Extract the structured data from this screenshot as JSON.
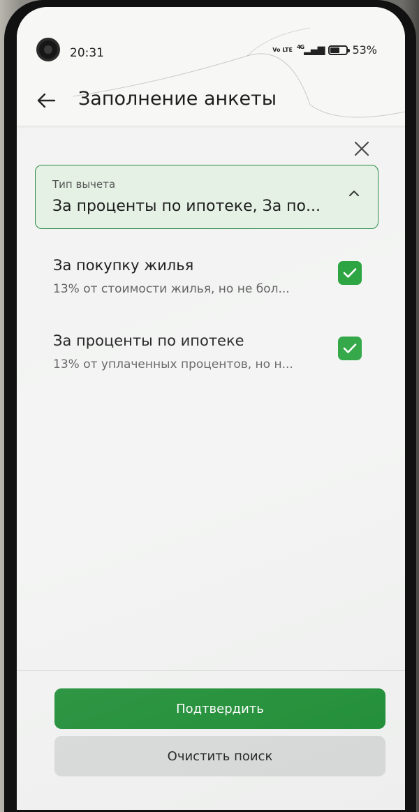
{
  "status_bar": {
    "time": "20:31",
    "network_volte": "Vo LTE",
    "network_type": "4G",
    "battery_percent": "53%"
  },
  "header": {
    "back_icon": "arrow-left-icon",
    "title": "Заполнение анкеты"
  },
  "close_icon": "close-icon",
  "deduction_select": {
    "label": "Тип вычета",
    "value": "За проценты по ипотеке, За по...",
    "expanded": true
  },
  "options": [
    {
      "title": "За покупку жилья",
      "description": "13% от стоимости жилья, но не бол...",
      "checked": true
    },
    {
      "title": "За проценты по ипотеке",
      "description": "13% от уплаченных процентов, но н...",
      "checked": true
    }
  ],
  "buttons": {
    "confirm_label": "Подтвердить",
    "clear_label": "Очистить поиск"
  },
  "colors": {
    "accent": "#21a038",
    "button_primary": "#1f8f36",
    "select_bg": "#e5f1e5",
    "secondary_button": "#d9dbdb"
  }
}
